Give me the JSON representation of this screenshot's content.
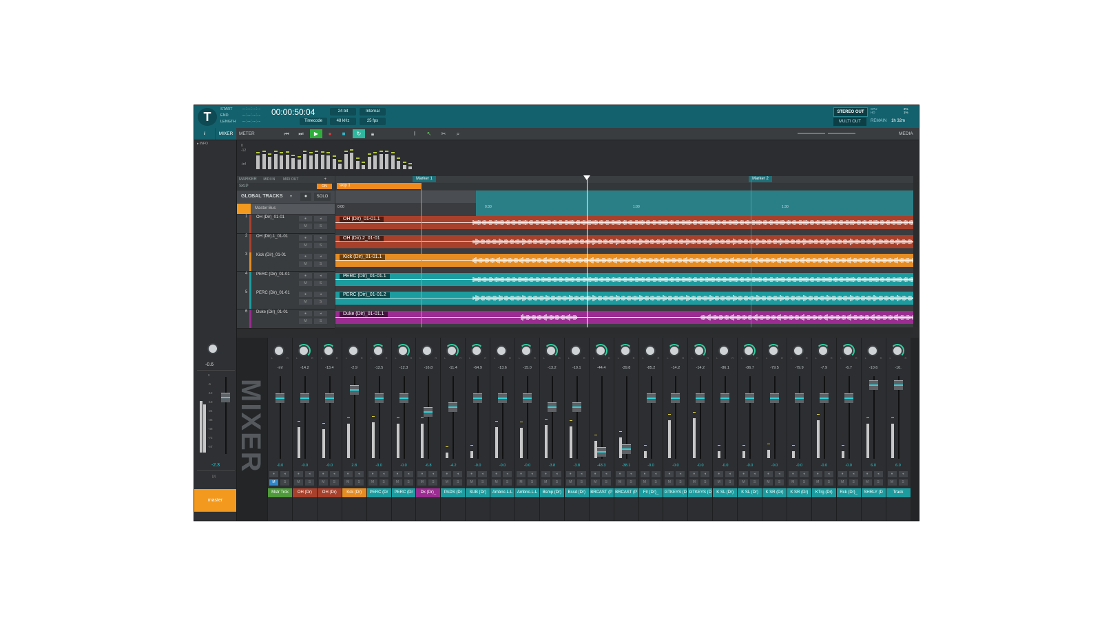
{
  "header": {
    "labels": [
      "START",
      "END",
      "LENGTH"
    ],
    "values": [
      "--:--:--:--",
      "--:--:--:--",
      "--:--:--:--"
    ],
    "timecode": "00:00:50:04",
    "bit_depth": "24 bit",
    "clock": "Internal",
    "time_format": "Timecode",
    "sample_rate": "48 kHz",
    "fps": "25 fps",
    "stereo_out": "STEREO OUT",
    "multi_out": "MULTI OUT",
    "cpu_label": "CPU",
    "cpu_value": "2%",
    "hd_label": "HD",
    "hd_value": "1%",
    "remain_label": "REMAIN",
    "remain_value": "1h 32m"
  },
  "toolbar": {
    "info_label": "i",
    "mixer_label": "MIXER",
    "meter_label": "METER",
    "media_label": "MEDIA"
  },
  "left_panel": {
    "info_label": "INFO",
    "master_db_top": "-0.6",
    "master_db_bottom": "-2.3",
    "master_m": "M",
    "master_label": "master",
    "scale": [
      "0",
      "-6",
      "-12",
      "-18",
      "-24",
      "-36",
      "-48",
      "-72",
      "-inf"
    ]
  },
  "meter_scale": [
    "0",
    "-12",
    "-inf"
  ],
  "ruler": {
    "marker_label": "MARKER",
    "skip_label": "SKIP",
    "midi_in": "MIDI IN",
    "midi_out": "MIDI OUT",
    "on_label": "ON",
    "markers": [
      "Marker 1",
      "Marker 2"
    ],
    "skip_region": "skip 1",
    "times": [
      "0:00",
      "0:30",
      "1:00",
      "1:30"
    ]
  },
  "global_tracks": {
    "label": "GLOBAL TRACKS",
    "solo": "SOLO",
    "master_bus": "Master Bus"
  },
  "tracks": [
    {
      "num": "1",
      "name": "OH (Dir)_01-01",
      "clip": "OH (Dir)_01-01.1",
      "color": "#a8412c"
    },
    {
      "num": "2",
      "name": "OH (Dir).1_01-01",
      "clip": "OH (Dir).2_01-01",
      "color": "#a8412c"
    },
    {
      "num": "3",
      "name": "Kick (Dir)_01-01",
      "clip": "Kick (Dir)_01-01.1",
      "color": "#e58c23"
    },
    {
      "num": "4",
      "name": "PERC (Dir)_01-01",
      "clip": "PERC (Dir)_01-01.1",
      "color": "#1d9c9f"
    },
    {
      "num": "5",
      "name": "PERC (Dir)_01-01",
      "clip": "PERC (Dir)_01-01.2",
      "color": "#1d9c9f"
    },
    {
      "num": "6",
      "name": "Duke (Dir)_01-01",
      "clip": "Duke (Dir)_01-01.1",
      "color": "#9b2c91"
    }
  ],
  "mixer": {
    "title": "MIXER",
    "channels": [
      {
        "name": "Mstr Trck",
        "db_top": "-inf",
        "db_bottom": "-0.0",
        "color": "#4f9a3b",
        "fader": 0.78,
        "level": 0.0
      },
      {
        "name": "OH (Dr)",
        "db_top": "-14.2",
        "db_bottom": "-0.0",
        "color": "#a8412c",
        "fader": 0.78,
        "level": 0.45
      },
      {
        "name": "OH (Dr)",
        "db_top": "-13.4",
        "db_bottom": "-0.0",
        "color": "#a8412c",
        "fader": 0.78,
        "level": 0.42
      },
      {
        "name": "Kck (Dr)",
        "db_top": "-2.9",
        "db_bottom": "2.8",
        "color": "#e58c23",
        "fader": 0.88,
        "level": 0.5
      },
      {
        "name": "PERC (Dr",
        "db_top": "-12.5",
        "db_bottom": "-0.0",
        "color": "#1d9c9f",
        "fader": 0.78,
        "level": 0.52
      },
      {
        "name": "PERC (Dr",
        "db_top": "-12.3",
        "db_bottom": "-0.0",
        "color": "#1d9c9f",
        "fader": 0.78,
        "level": 0.5
      },
      {
        "name": "Dk (Dr)_",
        "db_top": "-16.8",
        "db_bottom": "-6.8",
        "color": "#9b2c91",
        "fader": 0.6,
        "level": 0.5
      },
      {
        "name": "PADS (Dr",
        "db_top": "-11.4",
        "db_bottom": "-4.2",
        "color": "#1d9c9f",
        "fader": 0.66,
        "level": 0.08
      },
      {
        "name": "SUB (Dr)",
        "db_top": "-64.9",
        "db_bottom": "-0.0",
        "color": "#1d9c9f",
        "fader": 0.78,
        "level": 0.1
      },
      {
        "name": "Ambnc-L-L",
        "db_top": "-13.6",
        "db_bottom": "-0.0",
        "color": "#1d9c9f",
        "fader": 0.78,
        "level": 0.45
      },
      {
        "name": "Ambnc-L-L",
        "db_top": "-15.0",
        "db_bottom": "-0.0",
        "color": "#1d9c9f",
        "fader": 0.78,
        "level": 0.44
      },
      {
        "name": "Bsmp (Dr)",
        "db_top": "-13.2",
        "db_bottom": "-3.8",
        "color": "#1d9c9f",
        "fader": 0.66,
        "level": 0.48
      },
      {
        "name": "Bssd (Dr)",
        "db_top": "-10.1",
        "db_bottom": "-3.8",
        "color": "#1d9c9f",
        "fader": 0.66,
        "level": 0.46
      },
      {
        "name": "BRCAST (P",
        "db_top": "-44.4",
        "db_bottom": "-43.3",
        "color": "#1d9c9f",
        "fader": 0.08,
        "level": 0.25
      },
      {
        "name": "BRCAST (P",
        "db_top": "-39.8",
        "db_bottom": "-38.1",
        "color": "#1d9c9f",
        "fader": 0.12,
        "level": 0.3
      },
      {
        "name": "Flr (Dr)_",
        "db_top": "-85.2",
        "db_bottom": "-0.0",
        "color": "#1d9c9f",
        "fader": 0.78,
        "level": 0.1
      },
      {
        "name": "GTKEYS (D",
        "db_top": "-14.2",
        "db_bottom": "-0.0",
        "color": "#1d9c9f",
        "fader": 0.78,
        "level": 0.55
      },
      {
        "name": "GTKEYS (D",
        "db_top": "-14.2",
        "db_bottom": "-0.0",
        "color": "#1d9c9f",
        "fader": 0.78,
        "level": 0.58
      },
      {
        "name": "K SL (Dr)",
        "db_top": "-86.1",
        "db_bottom": "-0.0",
        "color": "#1d9c9f",
        "fader": 0.78,
        "level": 0.1
      },
      {
        "name": "K SL (Dr)",
        "db_top": "-86.7",
        "db_bottom": "-0.0",
        "color": "#1d9c9f",
        "fader": 0.78,
        "level": 0.1
      },
      {
        "name": "K SR (Dr)",
        "db_top": "-79.5",
        "db_bottom": "-0.0",
        "color": "#1d9c9f",
        "fader": 0.78,
        "level": 0.12
      },
      {
        "name": "K SR (Dr)",
        "db_top": "-79.9",
        "db_bottom": "-0.0",
        "color": "#1d9c9f",
        "fader": 0.78,
        "level": 0.1
      },
      {
        "name": "KTrg (Dr)",
        "db_top": "-7.9",
        "db_bottom": "-0.0",
        "color": "#1d9c9f",
        "fader": 0.78,
        "level": 0.55
      },
      {
        "name": "Rck (Dr)_",
        "db_top": "-6.7",
        "db_bottom": "-0.0",
        "color": "#1d9c9f",
        "fader": 0.78,
        "level": 0.1
      },
      {
        "name": "SHRLY (D",
        "db_top": "-10.6",
        "db_bottom": "6.0",
        "color": "#1d9c9f",
        "fader": 0.95,
        "level": 0.5
      },
      {
        "name": "Track",
        "db_top": "-10.",
        "db_bottom": "6.0",
        "color": "#1d9c9f",
        "fader": 0.95,
        "level": 0.5
      }
    ]
  }
}
